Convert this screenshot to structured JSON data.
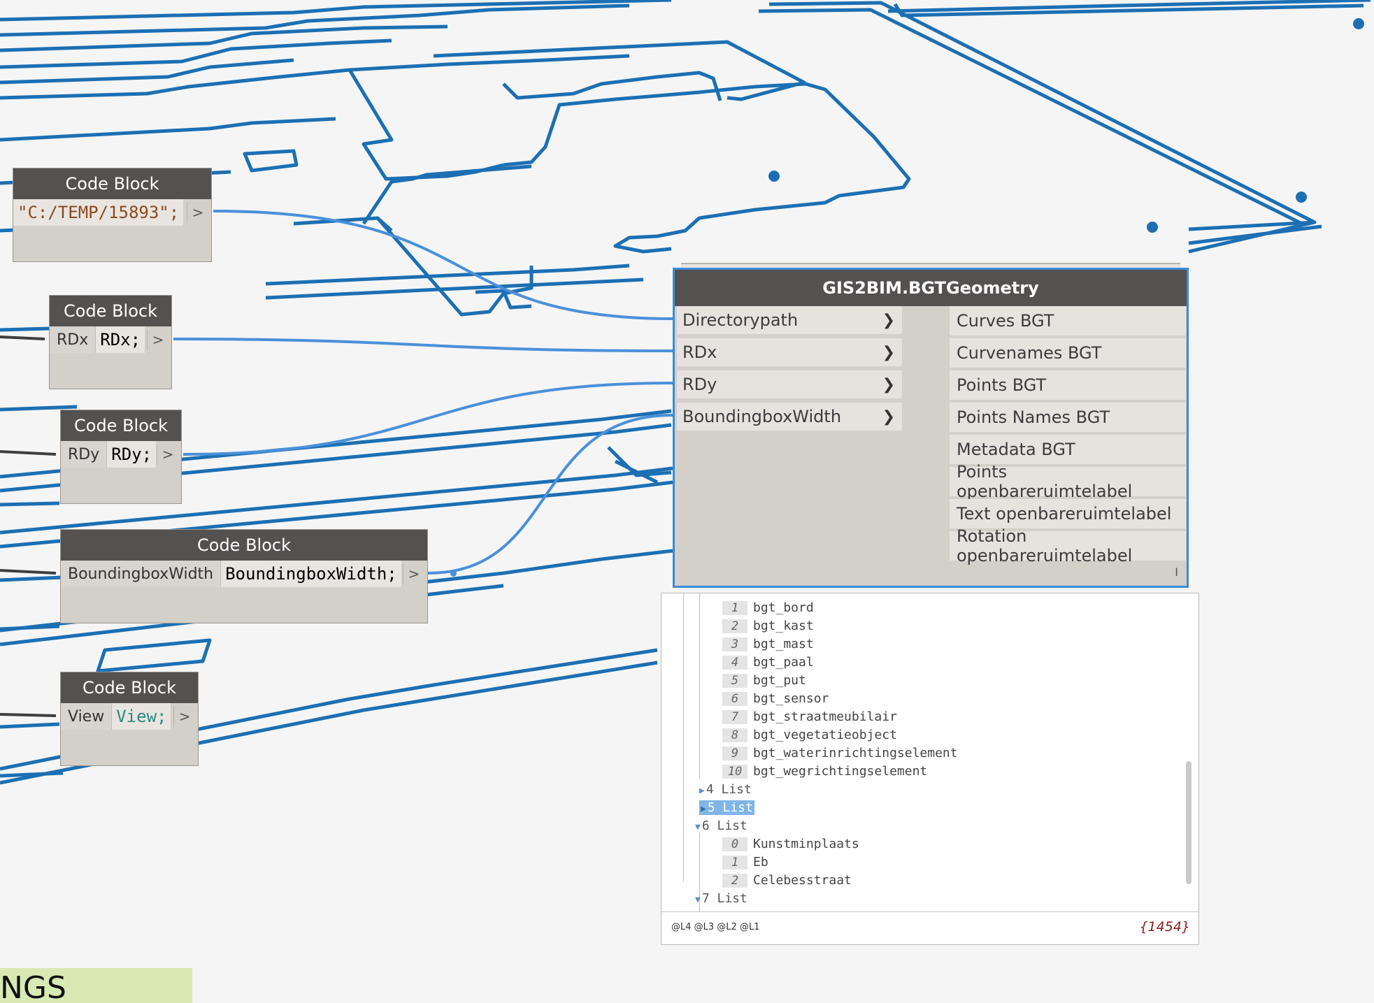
{
  "colors": {
    "canvas": "#f5f5f5",
    "geometry": "#1c6fb3",
    "wire": "#4a90d9",
    "node_header": "#545151",
    "node_body": "#d3cfc9",
    "selection": "#3a8bd6",
    "string_literal": "#8b4a1b",
    "keyword_view": "#2b8a7e"
  },
  "code_blocks": [
    {
      "title": "Code Block",
      "input_label": "",
      "code": "\"C:/TEMP/15893\";",
      "output": ">"
    },
    {
      "title": "Code Block",
      "input_label": "RDx",
      "code": "RDx;",
      "output": ">"
    },
    {
      "title": "Code Block",
      "input_label": "RDy",
      "code": "RDy;",
      "output": ">"
    },
    {
      "title": "Code Block",
      "input_label": "BoundingboxWidth",
      "code": "BoundingboxWidth;",
      "output": ">"
    },
    {
      "title": "Code Block",
      "input_label": "View",
      "code": "View;",
      "output": ">"
    }
  ],
  "bgt_node": {
    "title": "GIS2BIM.BGTGeometry",
    "inputs": [
      "Directorypath",
      "RDx",
      "RDy",
      "BoundingboxWidth"
    ],
    "outputs": [
      "Curves BGT",
      "Curvenames BGT",
      "Points BGT",
      "Points Names BGT",
      "Metadata BGT",
      "Points openbareruimtelabel",
      "Text openbareruimtelabel",
      "Rotation openbareruimtelabel"
    ],
    "resize_glyph": "I",
    "input_chevron": "❯"
  },
  "preview": {
    "items_top": [
      {
        "index": "1",
        "value": "bgt_bord"
      },
      {
        "index": "2",
        "value": "bgt_kast"
      },
      {
        "index": "3",
        "value": "bgt_mast"
      },
      {
        "index": "4",
        "value": "bgt_paal"
      },
      {
        "index": "5",
        "value": "bgt_put"
      },
      {
        "index": "6",
        "value": "bgt_sensor"
      },
      {
        "index": "7",
        "value": "bgt_straatmeubilair"
      },
      {
        "index": "8",
        "value": "bgt_vegetatieobject"
      },
      {
        "index": "9",
        "value": "bgt_waterinrichtingselement"
      },
      {
        "index": "10",
        "value": "bgt_wegrichtingselement"
      }
    ],
    "lists": [
      {
        "label": "4 List",
        "expanded": false,
        "selected": false
      },
      {
        "label": "5 List",
        "expanded": false,
        "selected": true
      },
      {
        "label": "6 List",
        "expanded": true,
        "selected": false
      },
      {
        "label": "7 List",
        "expanded": true,
        "selected": false
      }
    ],
    "items_list6": [
      {
        "index": "0",
        "value": "Kunstminplaats"
      },
      {
        "index": "1",
        "value": "Eb"
      },
      {
        "index": "2",
        "value": "Celebesstraat"
      }
    ],
    "levels": "@L4 @L3 @L2 @L1",
    "count": "{1454}"
  },
  "section_label": "NGS"
}
